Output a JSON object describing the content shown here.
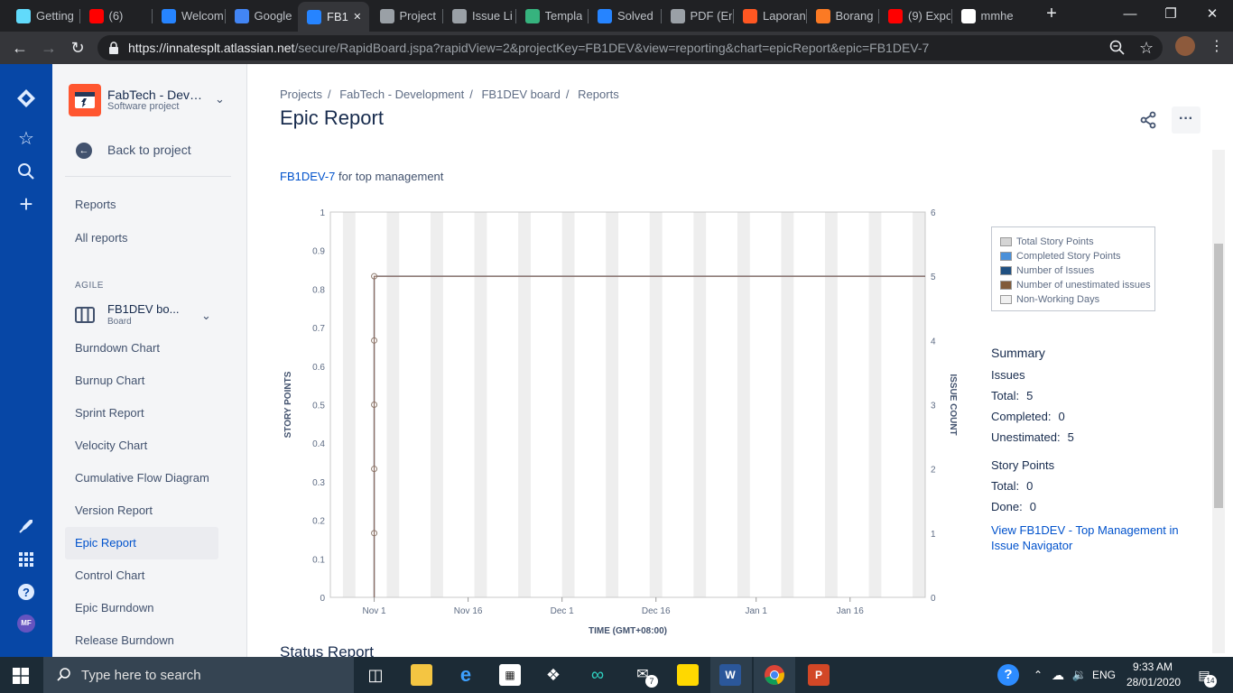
{
  "browser": {
    "tabs": [
      {
        "label": "Getting",
        "icon": "react-icon",
        "color": "#61dafb"
      },
      {
        "label": "(6)",
        "icon": "youtube-icon",
        "color": "#ff0000"
      },
      {
        "label": "Welcom",
        "icon": "atlassian-icon",
        "color": "#2684ff"
      },
      {
        "label": "Google",
        "icon": "google-translate-icon",
        "color": "#4285f4"
      },
      {
        "label": "FB1",
        "icon": "jira-icon",
        "color": "#2684ff",
        "active": true
      },
      {
        "label": "Project",
        "icon": "globe-icon",
        "color": "#9aa0a6"
      },
      {
        "label": "Issue Li",
        "icon": "globe-icon",
        "color": "#9aa0a6"
      },
      {
        "label": "Templa",
        "icon": "m-logo-icon",
        "color": "#36b37e"
      },
      {
        "label": "Solved",
        "icon": "atlassian-icon",
        "color": "#2684ff"
      },
      {
        "label": "PDF (En",
        "icon": "globe-icon",
        "color": "#9aa0a6"
      },
      {
        "label": "Laporan",
        "icon": "blogger-icon",
        "color": "#ff5722"
      },
      {
        "label": "Borang",
        "icon": "xampp-icon",
        "color": "#fb7a24"
      },
      {
        "label": "(9) Expo",
        "icon": "youtube-icon",
        "color": "#ff0000"
      },
      {
        "label": "mmhe",
        "icon": "google-icon",
        "color": "#ffffff"
      }
    ],
    "url_host": "https://innatesplt.atlassian.net",
    "url_path": "/secure/RapidBoard.jspa?rapidView=2&projectKey=FB1DEV&view=reporting&chart=epicReport&epic=FB1DEV-7"
  },
  "sidebar": {
    "project_name": "FabTech - Devel...",
    "project_type": "Software project",
    "back_label": "Back to project",
    "reports_heading": "Reports",
    "all_reports": "All reports",
    "agile_heading": "AGILE",
    "board_name": "FB1DEV bo...",
    "board_type": "Board",
    "items": [
      {
        "label": "Burndown Chart"
      },
      {
        "label": "Burnup Chart"
      },
      {
        "label": "Sprint Report"
      },
      {
        "label": "Velocity Chart"
      },
      {
        "label": "Cumulative Flow Diagram"
      },
      {
        "label": "Version Report"
      },
      {
        "label": "Epic Report",
        "active": true
      },
      {
        "label": "Control Chart"
      },
      {
        "label": "Epic Burndown"
      },
      {
        "label": "Release Burndown"
      }
    ]
  },
  "rail": {
    "avatar_initials": "MF"
  },
  "main": {
    "breadcrumb": [
      "Projects",
      "FabTech - Development",
      "FB1DEV board",
      "Reports"
    ],
    "title": "Epic Report",
    "epic_key": "FB1DEV-7",
    "epic_desc": "for top management",
    "status_report": "Status Report"
  },
  "chart_data": {
    "type": "line",
    "xlabel": "TIME (GMT+08:00)",
    "ylabel": "STORY POINTS",
    "y2label": "ISSUE COUNT",
    "ylim": [
      0,
      1
    ],
    "y2lim": [
      0,
      6
    ],
    "y_ticks": [
      0,
      0.1,
      0.2,
      0.3,
      0.4,
      0.5,
      0.6,
      0.7,
      0.8,
      0.9,
      1
    ],
    "y2_ticks": [
      0,
      1,
      2,
      3,
      4,
      5,
      6
    ],
    "x_ticks": [
      "Nov 1",
      "Nov 16",
      "Dec 1",
      "Dec 16",
      "Jan 1",
      "Jan 16"
    ],
    "x_range_days": [
      -7,
      88
    ],
    "x_tick_days": [
      0,
      15,
      30,
      45,
      61,
      76
    ],
    "series": [
      {
        "name": "Number of Issues",
        "color": "#7a869a",
        "points": [
          [
            0,
            0
          ],
          [
            0,
            1
          ],
          [
            0,
            2
          ],
          [
            0,
            3
          ],
          [
            0,
            4
          ],
          [
            0,
            5
          ],
          [
            88,
            5
          ]
        ],
        "markers": [
          1,
          2,
          3,
          4
        ]
      },
      {
        "name": "Number of unestimated issues",
        "color": "#8d6e63",
        "points": [
          [
            0,
            0
          ],
          [
            0,
            5
          ],
          [
            88,
            5
          ]
        ]
      }
    ],
    "legend": [
      {
        "label": "Total Story Points",
        "color": "#d5d5d5"
      },
      {
        "label": "Completed Story Points",
        "color": "#4a90d9"
      },
      {
        "label": "Number of Issues",
        "color": "#205081"
      },
      {
        "label": "Number of unestimated issues",
        "color": "#815b3a"
      },
      {
        "label": "Non-Working Days",
        "color": "#f0f0f0"
      }
    ],
    "legend_position": "right"
  },
  "summary": {
    "title": "Summary",
    "issues_heading": "Issues",
    "total_label": "Total:",
    "total_value": "5",
    "completed_label": "Completed:",
    "completed_value": "0",
    "unestimated_label": "Unestimated:",
    "unestimated_value": "5",
    "sp_heading": "Story Points",
    "sp_total_label": "Total:",
    "sp_total_value": "0",
    "sp_done_label": "Done:",
    "sp_done_value": "0",
    "link": "View FB1DEV - Top Management in Issue Navigator"
  },
  "taskbar": {
    "search_placeholder": "Type here to search",
    "time": "9:33 AM",
    "date": "28/01/2020",
    "lang": "ENG",
    "notif_count": "14",
    "mail_badge": "7"
  }
}
